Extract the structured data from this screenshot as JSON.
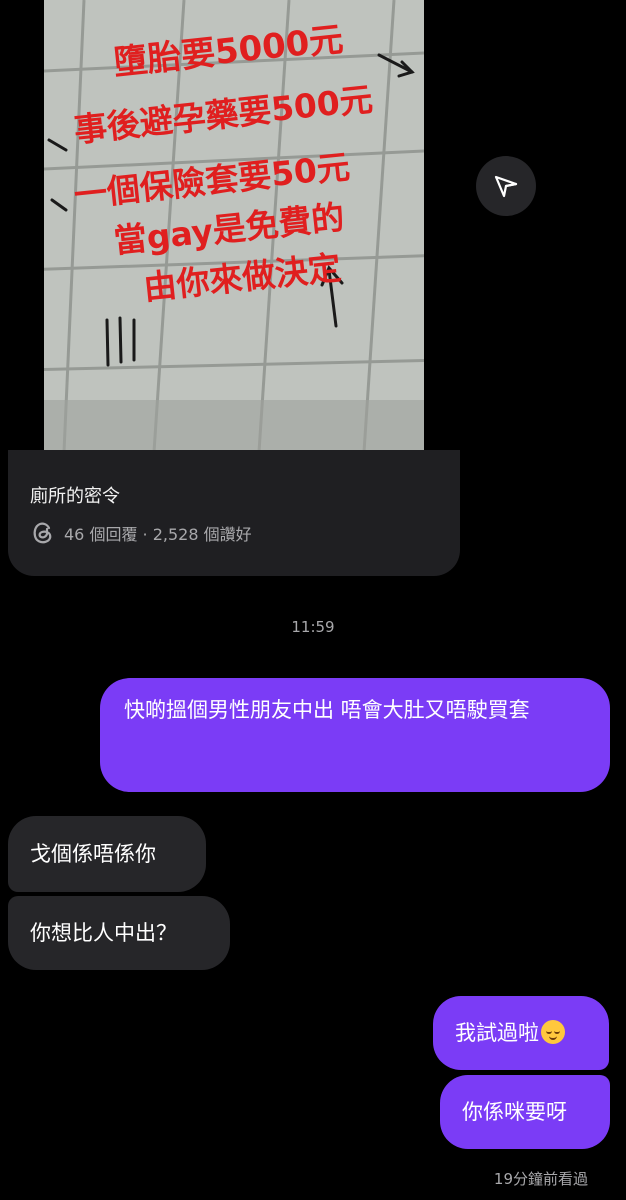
{
  "post": {
    "image_text": [
      "墮胎要5000元",
      "事後避孕藥要500元",
      "一個保險套要50元",
      "當gay是免費的",
      "由你來做決定"
    ],
    "title": "廁所的密令",
    "meta": "46 個回覆 · 2,528 個讚好"
  },
  "timestamp": "11:59",
  "messages": [
    {
      "sender": "me",
      "text": "快啲搵個男性朋友中出 唔會大肚又唔駛買套"
    },
    {
      "sender": "them",
      "text": "戈個係唔係你"
    },
    {
      "sender": "them",
      "text": "你想比人中出？"
    },
    {
      "sender": "me",
      "text": "我試過啦"
    },
    {
      "sender": "me",
      "text": "你係咪要呀"
    }
  ],
  "seen_status": "19分鐘前看過",
  "colors": {
    "sent_bubble": "#7b3cf6",
    "received_bubble": "#262629",
    "image_text": "#e01f1f"
  }
}
